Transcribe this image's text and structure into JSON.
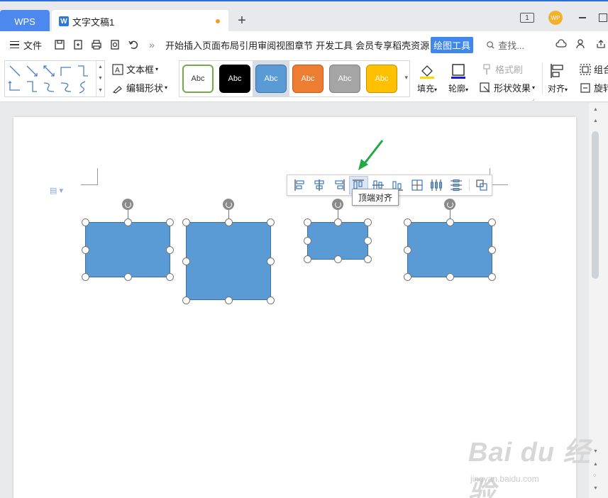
{
  "titlebar": {
    "app_tab": "WPS",
    "doc_tab": "文字文稿1",
    "add_tab": "+",
    "window_badge": "1",
    "avatar_text": "WP"
  },
  "menubar": {
    "file": "文件",
    "tabs": [
      "开始",
      "插入",
      "页面布局",
      "引用",
      "审阅",
      "视图",
      "章节",
      "开发工具",
      "会员专享",
      "稻壳资源"
    ],
    "active_tab": "绘图工具",
    "search": "查找...",
    "more": "»"
  },
  "ribbon": {
    "textbox": "文本框",
    "edit_shape": "编辑形状",
    "style_label": "Abc",
    "styles": [
      {
        "bg": "#ffffff",
        "border": "#70ad47",
        "color": "#333333"
      },
      {
        "bg": "#000000",
        "border": "#000000",
        "color": "#ffffff"
      },
      {
        "bg": "#5b9bd5",
        "border": "#41719c",
        "color": "#ffffff"
      },
      {
        "bg": "#ed7d31",
        "border": "#c55a11",
        "color": "#ffffff"
      },
      {
        "bg": "#a5a5a5",
        "border": "#7f7f7f",
        "color": "#ffffff"
      },
      {
        "bg": "#ffc000",
        "border": "#c09200",
        "color": "#ffffff"
      }
    ],
    "fill": "填充",
    "outline": "轮廓",
    "format_painter": "格式刷",
    "shape_effects": "形状效果",
    "align": "对齐",
    "group": "组合",
    "rotate": "旋转"
  },
  "canvas": {
    "tooltip": "顶端对齐",
    "shape_color": "#5b9bd5",
    "watermark": "Bai du 经验",
    "watermark_sub": "jingyan.baidu.com"
  }
}
